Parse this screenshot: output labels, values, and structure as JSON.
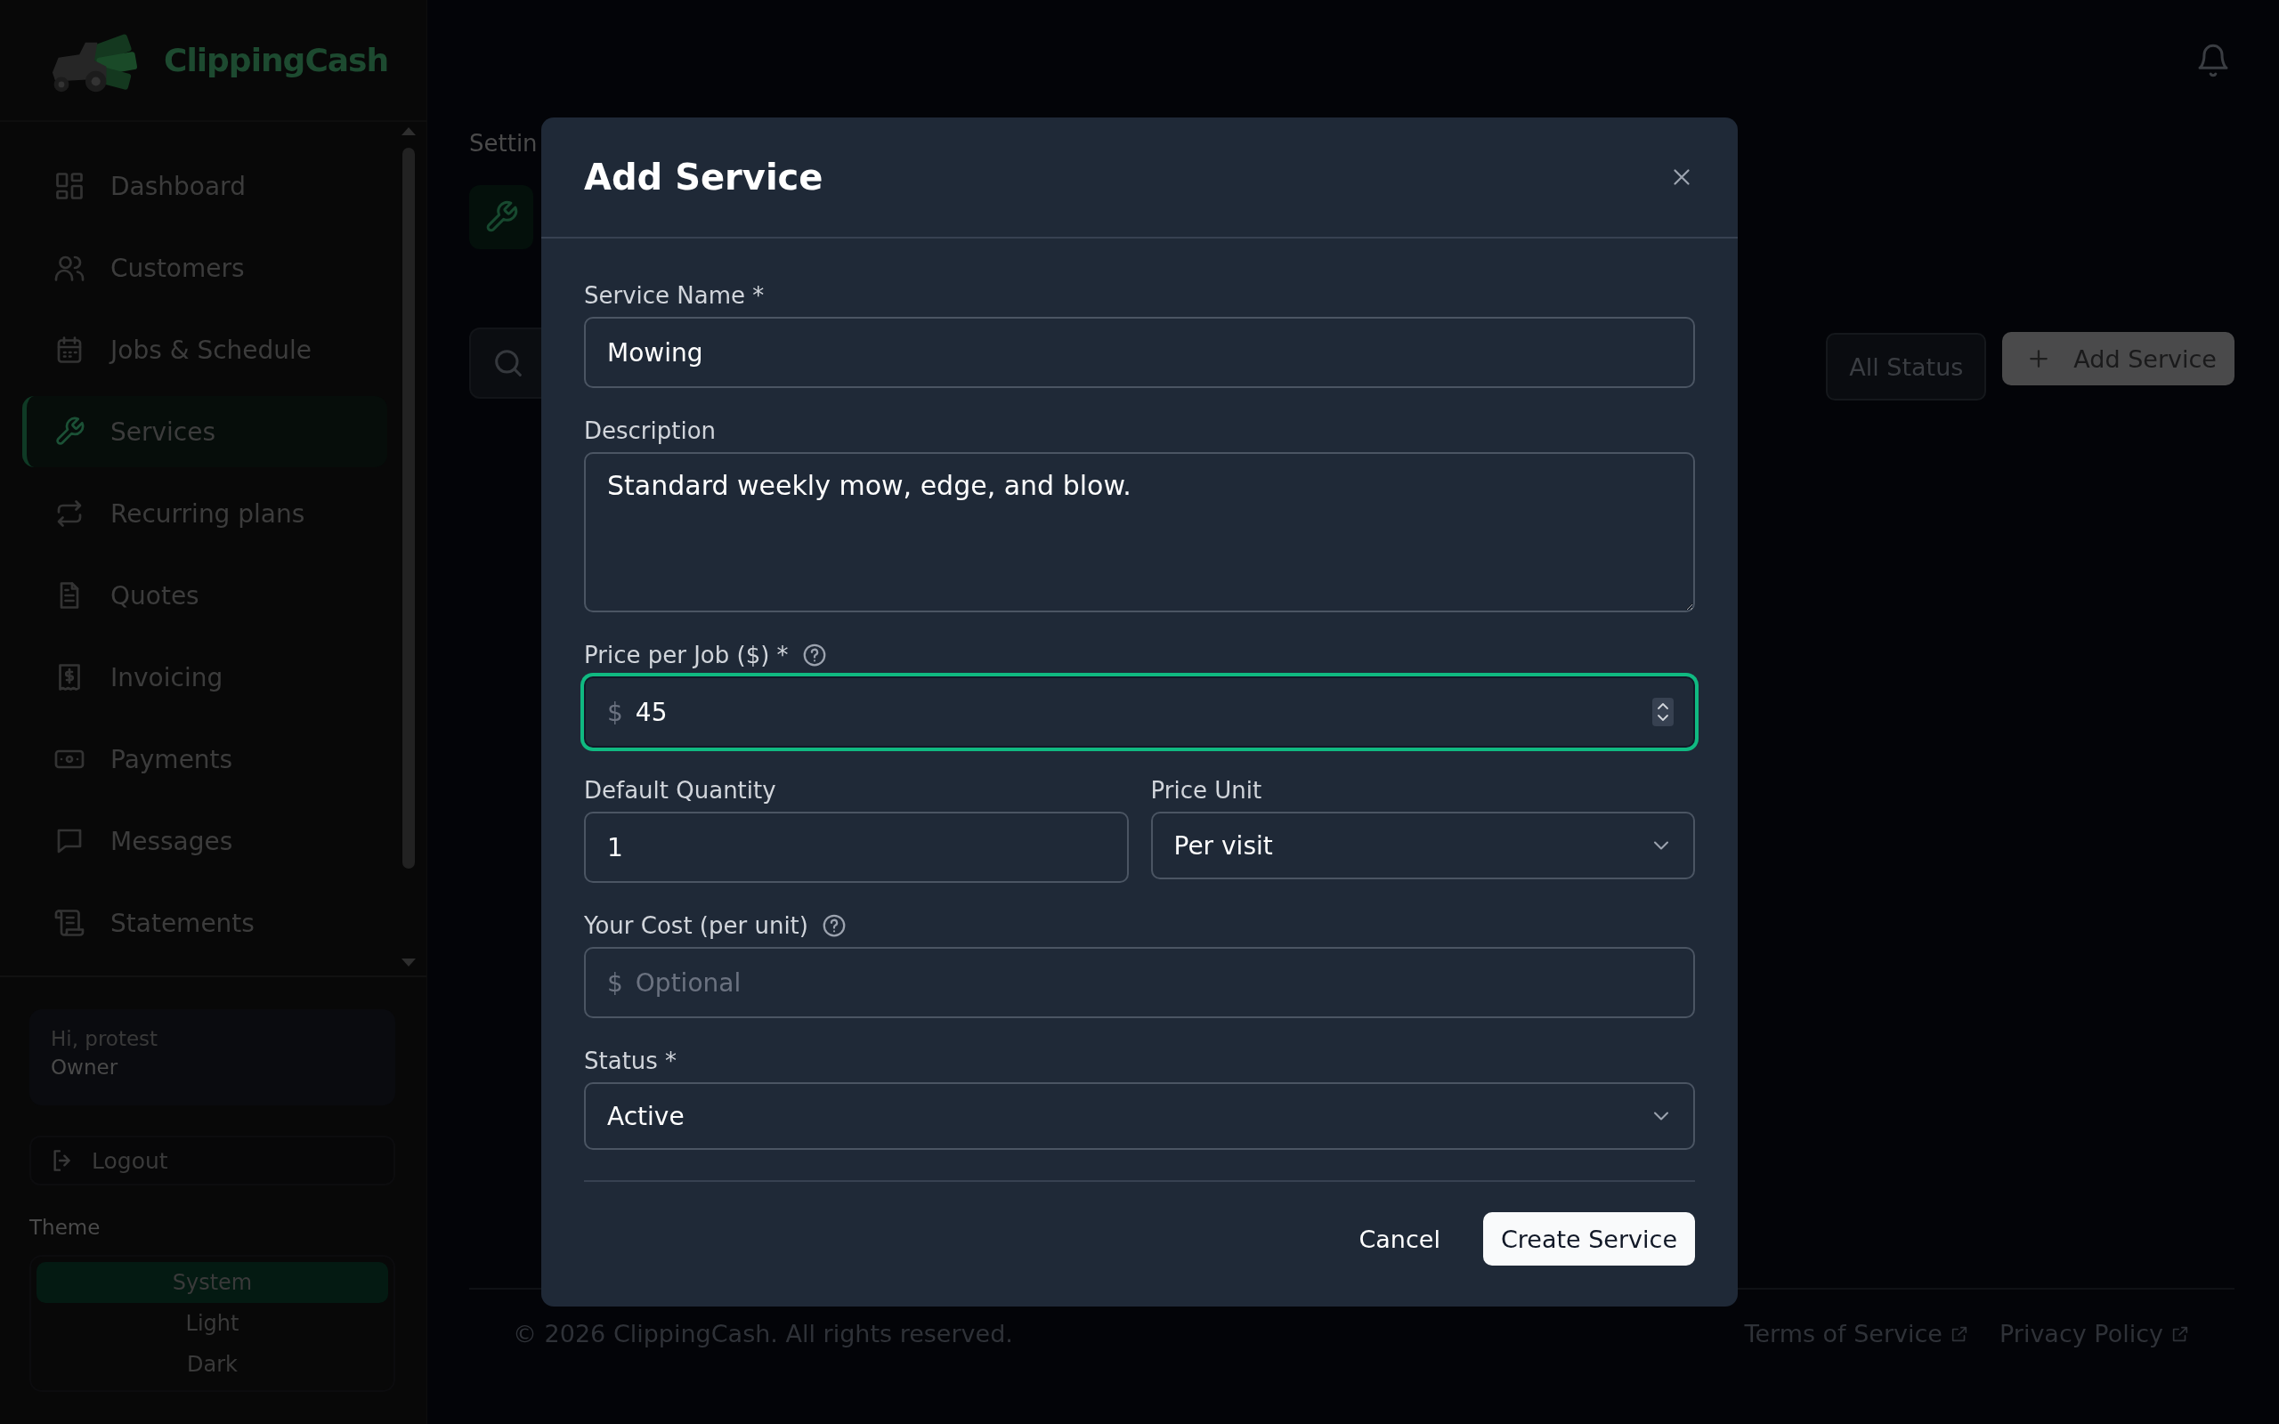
{
  "app": {
    "name": "ClippingCash"
  },
  "sidebar": {
    "items": [
      {
        "label": "Dashboard",
        "selected": false
      },
      {
        "label": "Customers",
        "selected": false
      },
      {
        "label": "Jobs & Schedule",
        "selected": false
      },
      {
        "label": "Services",
        "selected": true
      },
      {
        "label": "Recurring plans",
        "selected": false
      },
      {
        "label": "Quotes",
        "selected": false
      },
      {
        "label": "Invoicing",
        "selected": false
      },
      {
        "label": "Payments",
        "selected": false
      },
      {
        "label": "Messages",
        "selected": false
      },
      {
        "label": "Statements",
        "selected": false
      }
    ],
    "user": {
      "greeting": "Hi, protest",
      "role": "Owner"
    },
    "logout": "Logout",
    "theme": {
      "label": "Theme",
      "options": [
        {
          "label": "System",
          "selected": true
        },
        {
          "label": "Light",
          "selected": false
        },
        {
          "label": "Dark",
          "selected": false
        }
      ]
    }
  },
  "page": {
    "breadcrumb": "Settin",
    "filter": "All Status",
    "add_button": "Add Service"
  },
  "footer": {
    "copyright": "© 2026 ClippingCash. All rights reserved.",
    "links": [
      "Terms of Service",
      "Privacy Policy"
    ]
  },
  "modal": {
    "title": "Add Service",
    "rows": [
      {
        "fields": [
          {
            "kind": "text",
            "label": "Service Name *",
            "value": "Mowing",
            "help": false,
            "focused": false
          }
        ]
      },
      {
        "fields": [
          {
            "kind": "textarea",
            "label": "Description",
            "value": "Standard weekly mow, edge, and blow.",
            "help": false,
            "focused": false
          }
        ]
      },
      {
        "fields": [
          {
            "kind": "number",
            "label": "Price per Job ($) *",
            "prefix": "$",
            "value": "45",
            "help": true,
            "focused": true
          }
        ]
      },
      {
        "fields": [
          {
            "kind": "text",
            "label": "Default Quantity",
            "value": "1",
            "help": false,
            "focused": false
          },
          {
            "kind": "select",
            "label": "Price Unit",
            "value": "Per visit",
            "help": false,
            "focused": false
          }
        ]
      },
      {
        "fields": [
          {
            "kind": "text",
            "label": "Your Cost (per unit)",
            "prefix": "$",
            "placeholder": "Optional",
            "help": true,
            "focused": false
          }
        ]
      },
      {
        "fields": [
          {
            "kind": "select",
            "label": "Status *",
            "value": "Active",
            "help": false,
            "focused": false
          }
        ]
      }
    ],
    "buttons": {
      "cancel": "Cancel",
      "submit": "Create Service"
    }
  }
}
